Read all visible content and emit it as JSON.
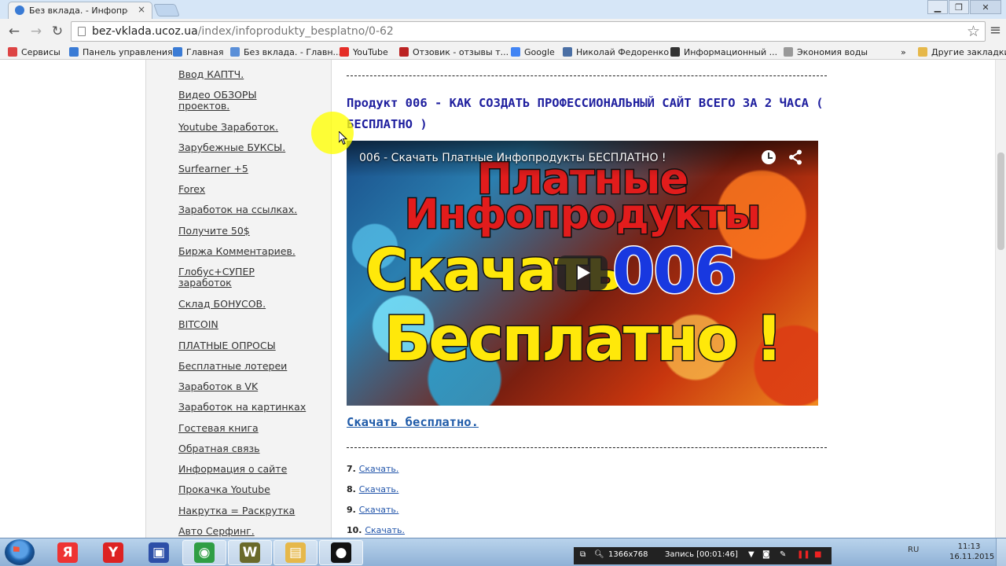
{
  "browser": {
    "tab_title": "Без вклада. - Инфопродукты",
    "tab_close": "×",
    "window_buttons": {
      "minimize": "▁",
      "maximize": "❐",
      "close": "✕"
    },
    "url_host": "bez-vklada.ucoz.ua",
    "url_path": "/index/infoprodukty_besplatno/0-62",
    "nav": {
      "back": "←",
      "forward": "→",
      "reload": "↻"
    },
    "star": "☆",
    "menu": "≡",
    "bookmarks": [
      {
        "label": "Сервисы",
        "icon": "apps-icon",
        "color": "#d44"
      },
      {
        "label": "Панель управления",
        "icon": "ucoz-icon",
        "color": "#3a7bd5"
      },
      {
        "label": "Главная",
        "icon": "ucoz-icon",
        "color": "#3a7bd5"
      },
      {
        "label": "Без вклада. - Главн...",
        "icon": "site-icon",
        "color": "#5a8fd8"
      },
      {
        "label": "YouTube",
        "icon": "youtube-icon",
        "color": "#e52d27"
      },
      {
        "label": "Отзовик - отзывы т...",
        "icon": "otzovik-icon",
        "color": "#b22"
      },
      {
        "label": "Google",
        "icon": "google-icon",
        "color": "#4285f4"
      },
      {
        "label": "Николай Федоренко",
        "icon": "vk-icon",
        "color": "#4a6fa5"
      },
      {
        "label": "Информационный ...",
        "icon": "page-icon",
        "color": "#333"
      },
      {
        "label": "Экономия воды",
        "icon": "page-icon",
        "color": "#999"
      }
    ],
    "bookmarks_more": "»",
    "other_bookmarks": "Другие закладки"
  },
  "sidebar": {
    "items": [
      {
        "label": "Ввод КАПТЧ."
      },
      {
        "label": "Видео ОБЗОРЫ проектов."
      },
      {
        "label": "Youtube Заработок."
      },
      {
        "label": "Зарубежные БУКСЫ."
      },
      {
        "label": "Surfearner +5"
      },
      {
        "label": "Forex"
      },
      {
        "label": "Заработок на ссылках."
      },
      {
        "label": "Получите 50$"
      },
      {
        "label": "Биржа Комментариев."
      },
      {
        "label": "Глобус+СУПЕР заработок"
      },
      {
        "label": "Склад БОНУСОВ."
      },
      {
        "label": "BITCOIN"
      },
      {
        "label": "ПЛАТНЫЕ ОПРОСЫ"
      },
      {
        "label": "Бесплатные лотереи"
      },
      {
        "label": "Заработок в VK"
      },
      {
        "label": "Заработок на картинках"
      },
      {
        "label": "Гостевая книга"
      },
      {
        "label": "Обратная связь"
      },
      {
        "label": "Информация о сайте"
      },
      {
        "label": "Прокачка Youtube"
      },
      {
        "label": "Накрутка = Раскрутка"
      },
      {
        "label": "Авто Серфинг."
      }
    ]
  },
  "content": {
    "product_title": "Продукт 006 - КАК СОЗДАТЬ ПРОФЕССИОНАЛЬНЫЙ САЙТ ВСЕГО  ЗА 2 ЧАСА ( БЕСПЛАТНО )",
    "video": {
      "label": "006 - Скачать Платные Инфопродукты БЕСПЛАТНО !",
      "line1": "Платные",
      "line2": "Инфопродукты",
      "line3": "Скачать",
      "line3b": "006",
      "line4": "Бесплатно !"
    },
    "download_link": "Скачать бесплатно.",
    "items": [
      {
        "num": "7.",
        "link": "Скачать."
      },
      {
        "num": "8.",
        "link": "Скачать."
      },
      {
        "num": "9.",
        "link": "Скачать."
      },
      {
        "num": "10.",
        "link": "Скачать."
      }
    ]
  },
  "taskbar": {
    "apps": [
      {
        "name": "yandex-icon",
        "glyph": "Я",
        "color": "#e33"
      },
      {
        "name": "yandex-browser-icon",
        "glyph": "Y",
        "color": "#d22"
      },
      {
        "name": "floppy-icon",
        "glyph": "▣",
        "color": "#2d4fa8"
      },
      {
        "name": "chrome-icon",
        "glyph": "◉",
        "color": "#2f9e44"
      },
      {
        "name": "world-of-tanks-icon",
        "glyph": "W",
        "color": "#6a6a2a"
      },
      {
        "name": "folder-icon",
        "glyph": "▤",
        "color": "#e6b84a"
      },
      {
        "name": "record-icon",
        "glyph": "●",
        "color": "#111"
      }
    ],
    "recorder": {
      "resolution": "1366x768",
      "status": "Запись [00:01:46]"
    },
    "lang": "RU",
    "time": "11:13",
    "date": "16.11.2015"
  },
  "colors": {
    "title_text": "#1e1e9e",
    "link": "#1e5aa8",
    "sidebar_bg": "#f3f3f3",
    "cursor_highlight": "#ffff00"
  }
}
